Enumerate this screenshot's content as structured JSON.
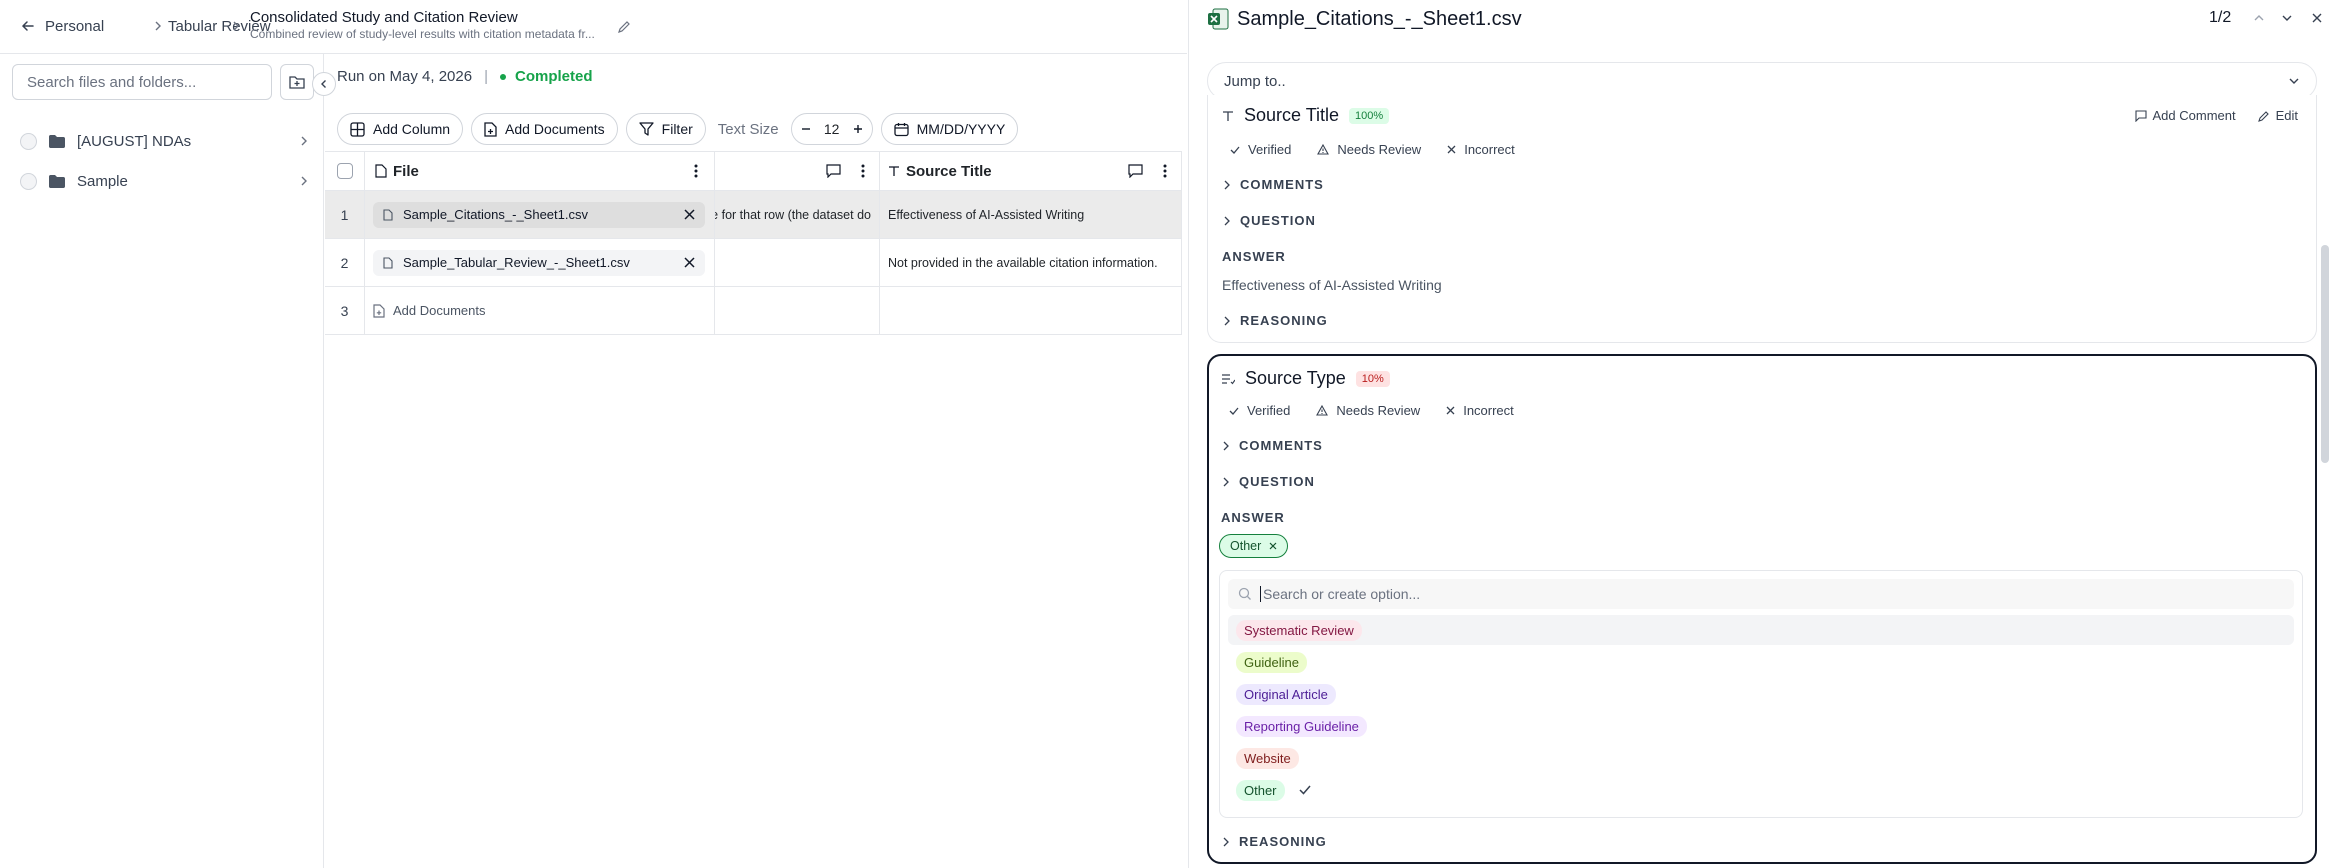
{
  "breadcrumb": {
    "back_icon": "arrow-left-icon",
    "items": [
      "Personal",
      "Tabular Review"
    ]
  },
  "document": {
    "title": "Consolidated Study and Citation Review",
    "subtitle": "Combined review of study-level results with citation metadata fr..."
  },
  "sidebar": {
    "search_placeholder": "Search files and folders...",
    "folders": [
      {
        "label": "[AUGUST] NDAs"
      },
      {
        "label": "Sample"
      }
    ]
  },
  "run": {
    "text": "Run on May 4, 2026",
    "separator": "|",
    "status": "Completed",
    "status_color": "#16a34a"
  },
  "toolbar": {
    "add_column": "Add Column",
    "add_documents": "Add Documents",
    "filter": "Filter",
    "text_size_label": "Text Size",
    "text_size_value": "12",
    "date_format": "MM/DD/YYYY"
  },
  "grid": {
    "headers": {
      "file": "File",
      "source_title": "Source Title"
    },
    "rows": [
      {
        "num": "1",
        "file": "Sample_Citations_-_Sheet1.csv",
        "middle": "e for that row (the dataset do",
        "source_title": "Effectiveness of AI-Assisted Writing"
      },
      {
        "num": "2",
        "file": "Sample_Tabular_Review_-_Sheet1.csv",
        "middle": "",
        "source_title": "Not provided in the available citation information."
      },
      {
        "num": "3",
        "add_label": "Add Documents"
      }
    ]
  },
  "panel": {
    "file_name": "Sample_Citations_-_Sheet1.csv",
    "pager": "1/2",
    "jump_placeholder": "Jump to..",
    "card1": {
      "title": "Source Title",
      "confidence": "100%",
      "add_comment": "Add Comment",
      "edit": "Edit",
      "verified": "Verified",
      "needs_review": "Needs Review",
      "incorrect": "Incorrect",
      "comments": "COMMENTS",
      "question": "QUESTION",
      "answer_label": "ANSWER",
      "answer": "Effectiveness of AI-Assisted Writing",
      "reasoning": "REASONING"
    },
    "card2": {
      "title": "Source Type",
      "confidence": "10%",
      "verified": "Verified",
      "needs_review": "Needs Review",
      "incorrect": "Incorrect",
      "comments": "COMMENTS",
      "question": "QUESTION",
      "answer_label": "ANSWER",
      "selected_tag": "Other",
      "search_placeholder": "Search or create option...",
      "options": [
        "Systematic Review",
        "Guideline",
        "Original Article",
        "Reporting Guideline",
        "Website",
        "Other"
      ],
      "reasoning": "REASONING"
    }
  },
  "colors": {
    "confidence_high_bg": "#dcfce7",
    "confidence_high_fg": "#15803d",
    "confidence_low_bg": "#fee2e2",
    "confidence_low_fg": "#b91c1c",
    "excel_green": "#1d6f42"
  }
}
